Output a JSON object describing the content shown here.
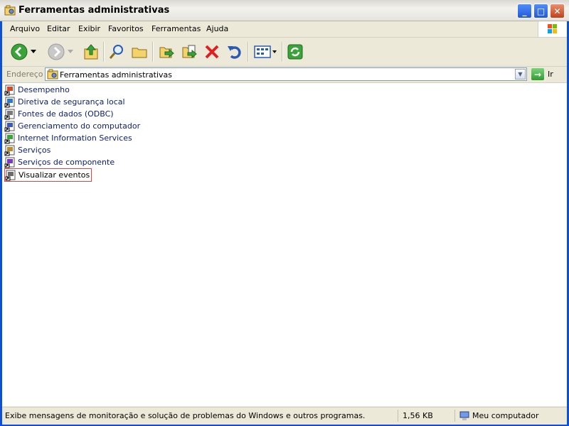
{
  "window": {
    "title": "Ferramentas administrativas",
    "minimize_label": "_",
    "maximize_label": "□",
    "close_label": "✕"
  },
  "menu": {
    "items": [
      "Arquivo",
      "Editar",
      "Exibir",
      "Favoritos",
      "Ferramentas",
      "Ajuda"
    ]
  },
  "toolbar": {
    "tools": [
      "back-icon",
      "forward-icon",
      "up-icon",
      "search-icon",
      "folders-icon",
      "move-to-icon",
      "copy-to-icon",
      "delete-icon",
      "undo-icon",
      "views-icon",
      "sync-icon"
    ]
  },
  "address": {
    "label": "Endereço",
    "value": "Ferramentas administrativas",
    "go_label": "Ir"
  },
  "files": {
    "items": [
      {
        "label": "Desempenho",
        "icon": "performance-shortcut-icon"
      },
      {
        "label": "Diretiva de segurança local",
        "icon": "security-policy-shortcut-icon"
      },
      {
        "label": "Fontes de dados (ODBC)",
        "icon": "odbc-shortcut-icon"
      },
      {
        "label": "Gerenciamento do computador",
        "icon": "computer-management-shortcut-icon"
      },
      {
        "label": "Internet Information Services",
        "icon": "iis-shortcut-icon"
      },
      {
        "label": "Serviços",
        "icon": "services-shortcut-icon"
      },
      {
        "label": "Serviços de componente",
        "icon": "component-services-shortcut-icon"
      },
      {
        "label": "Visualizar eventos",
        "icon": "event-viewer-shortcut-icon",
        "selected": true
      }
    ]
  },
  "status": {
    "message": "Exibe mensagens de monitoração e solução de problemas do Windows e outros programas.",
    "size": "1,56 KB",
    "zone": "Meu computador"
  },
  "colors": {
    "title_accent": "#0c4fd8",
    "link_text": "#0a1e6e",
    "selection_border": "#e04444"
  }
}
